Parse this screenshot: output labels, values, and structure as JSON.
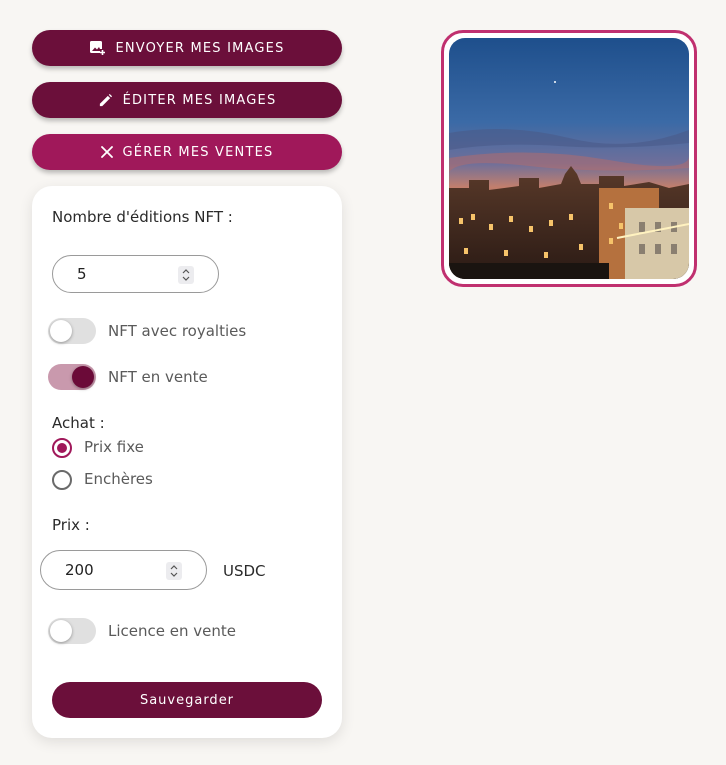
{
  "buttons": {
    "upload_label": "ENVOYER MES IMAGES",
    "edit_label": "ÉDITER MES IMAGES",
    "manage_label": "GÉRER MES VENTES"
  },
  "form": {
    "editions_label": "Nombre d'éditions NFT :",
    "editions_value": "5",
    "royalties_label": "NFT avec royalties",
    "royalties_on": false,
    "for_sale_label": "NFT en vente",
    "for_sale_on": true,
    "purchase_label": "Achat :",
    "purchase_options": [
      "Prix fixe",
      "Enchères"
    ],
    "purchase_selected": "Prix fixe",
    "price_label": "Prix :",
    "price_value": "200",
    "currency": "USDC",
    "license_label": "Licence en vente",
    "license_on": false,
    "save_label": "Sauvegarder"
  },
  "colors": {
    "primary_dark": "#6b0f3a",
    "primary_active": "#a0185a",
    "frame_border": "#c0306f",
    "toggle_track_on": "#c999ad"
  },
  "icons": {
    "upload": "add-photo-icon",
    "edit": "pencil-icon",
    "manage": "close-icon"
  }
}
